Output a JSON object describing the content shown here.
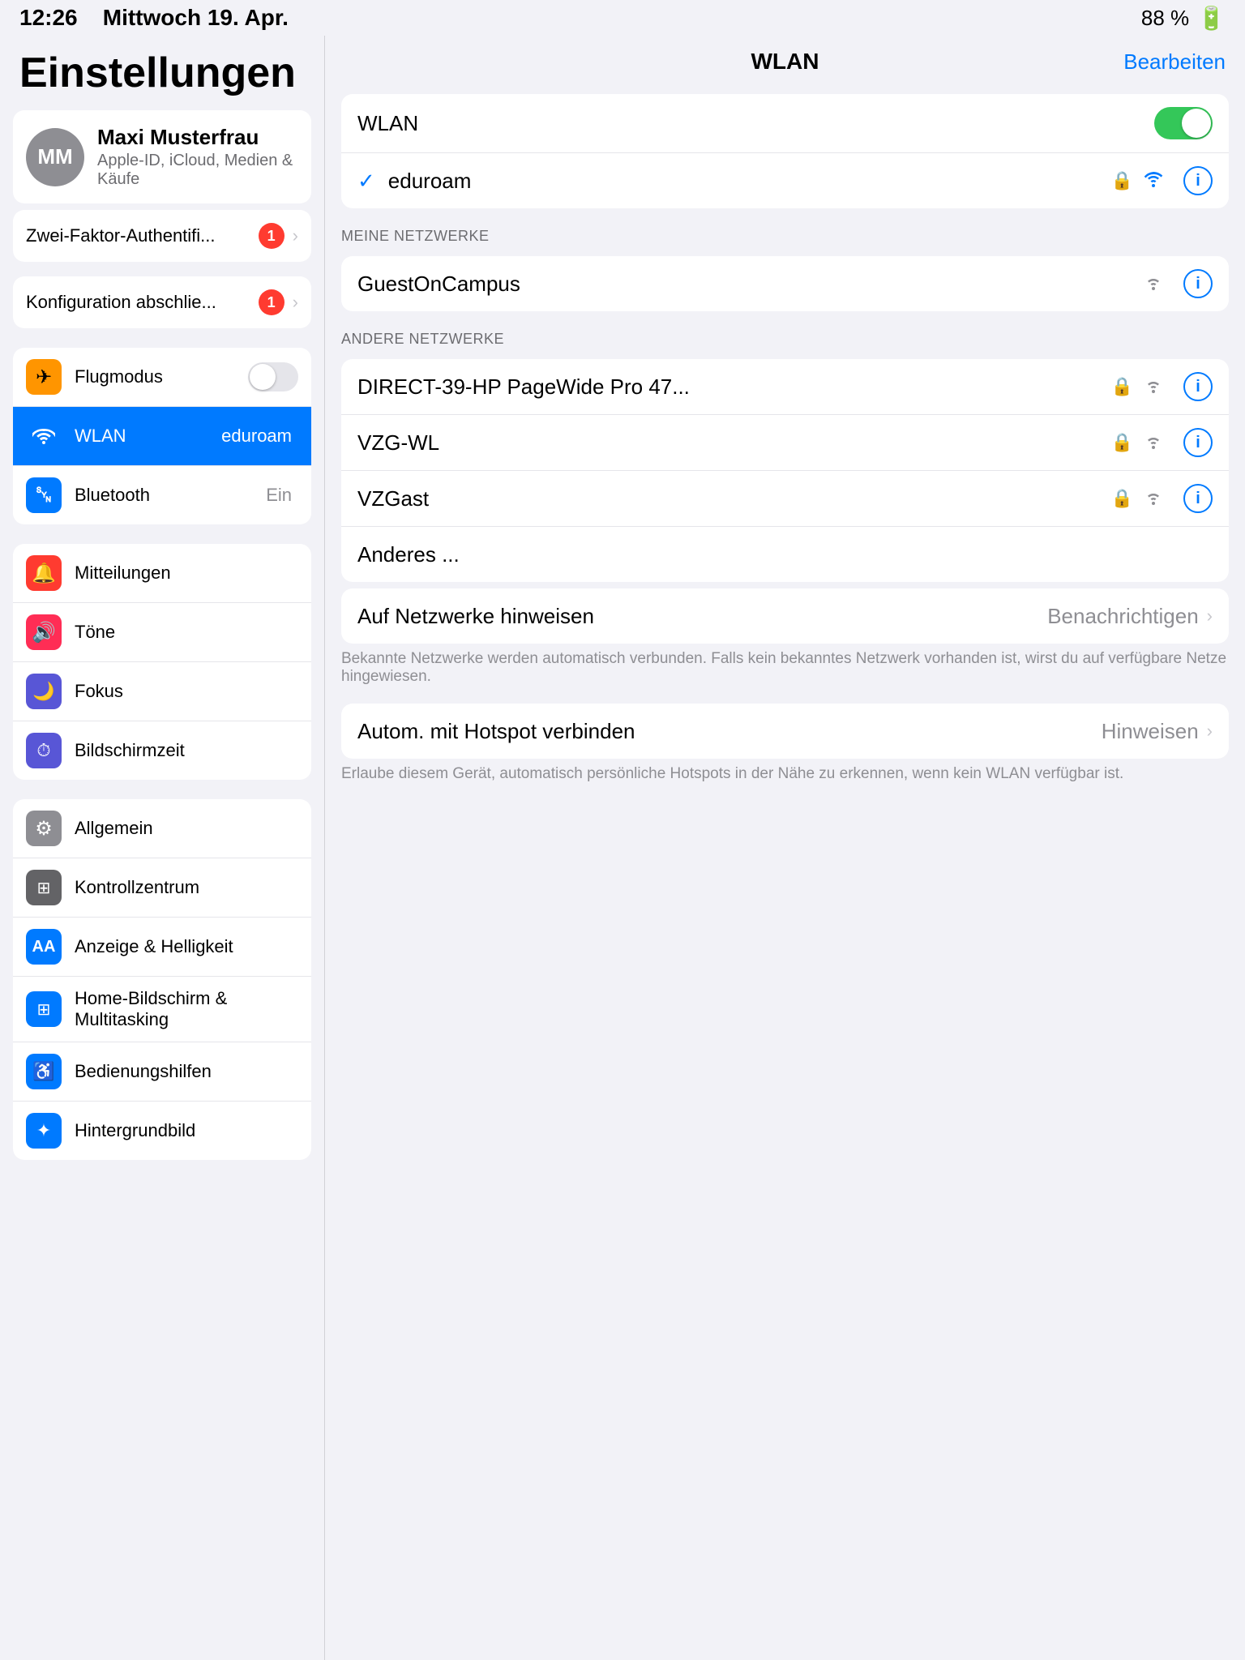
{
  "statusBar": {
    "time": "12:26",
    "day": "Mittwoch 19. Apr.",
    "battery": "88 %"
  },
  "sidebar": {
    "title": "Einstellungen",
    "account": {
      "initials": "MM",
      "name": "Maxi Musterfrau",
      "subtitle": "Apple-ID, iCloud, Medien & Käufe"
    },
    "twoFactor": {
      "label": "Zwei-Faktor-Authentifi...",
      "badge": "1"
    },
    "config": {
      "label": "Konfiguration abschlie...",
      "badge": "1"
    },
    "group1": [
      {
        "id": "flugmodus",
        "icon": "✈",
        "iconColor": "orange",
        "label": "Flugmodus",
        "toggle": true,
        "toggleOn": false
      },
      {
        "id": "wlan",
        "icon": "📶",
        "iconColor": "blue",
        "label": "WLAN",
        "value": "eduroam",
        "selected": true
      },
      {
        "id": "bluetooth",
        "icon": "🔵",
        "iconColor": "blue2",
        "label": "Bluetooth",
        "value": "Ein"
      }
    ],
    "group2": [
      {
        "id": "mitteilungen",
        "icon": "🔔",
        "iconColor": "red",
        "label": "Mitteilungen"
      },
      {
        "id": "toene",
        "icon": "🔊",
        "iconColor": "red2",
        "label": "Töne"
      },
      {
        "id": "fokus",
        "icon": "🌙",
        "iconColor": "indigo",
        "label": "Fokus"
      },
      {
        "id": "bildschirmzeit",
        "icon": "⏱",
        "iconColor": "purple",
        "label": "Bildschirmzeit"
      }
    ],
    "group3": [
      {
        "id": "allgemein",
        "icon": "⚙",
        "iconColor": "gray",
        "label": "Allgemein"
      },
      {
        "id": "kontrollzentrum",
        "icon": "🔲",
        "iconColor": "gray2",
        "label": "Kontrollzentrum"
      },
      {
        "id": "anzeige",
        "icon": "AA",
        "iconColor": "blue2",
        "label": "Anzeige & Helligkeit"
      },
      {
        "id": "home",
        "icon": "⊞",
        "iconColor": "blue",
        "label": "Home-Bildschirm & Multitasking"
      },
      {
        "id": "bedienungshilfen",
        "icon": "♿",
        "iconColor": "blue2",
        "label": "Bedienungshilfen"
      },
      {
        "id": "hintergrundbild",
        "icon": "✦",
        "iconColor": "blue",
        "label": "Hintergrundbild"
      }
    ]
  },
  "rightPanel": {
    "title": "WLAN",
    "editButton": "Bearbeiten",
    "wlanToggle": {
      "label": "WLAN",
      "on": true
    },
    "connectedNetwork": {
      "name": "eduroam",
      "secured": true,
      "signalStrength": 3
    },
    "mineNetworksHeader": "MEINE NETZWERKE",
    "myNetworks": [
      {
        "name": "GuestOnCampus",
        "secured": false,
        "signalStrength": 2
      }
    ],
    "otherNetworksHeader": "ANDERE NETZWERKE",
    "otherNetworks": [
      {
        "name": "DIRECT-39-HP PageWide Pro 47...",
        "secured": true,
        "signalStrength": 2
      },
      {
        "name": "VZG-WL",
        "secured": true,
        "signalStrength": 2
      },
      {
        "name": "VZGast",
        "secured": true,
        "signalStrength": 2
      },
      {
        "name": "Anderes ...",
        "secured": false,
        "signalStrength": 0
      }
    ],
    "notifySection": {
      "label": "Auf Netzwerke hinweisen",
      "value": "Benachrichtigen",
      "description": "Bekannte Netzwerke werden automatisch verbunden. Falls kein bekanntes Netzwerk vorhanden ist, wirst du auf verfügbare Netze hingewiesen."
    },
    "hotspotSection": {
      "label": "Autom. mit Hotspot verbinden",
      "value": "Hinweisen",
      "description": "Erlaube diesem Gerät, automatisch persönliche Hotspots in der Nähe zu erkennen, wenn kein WLAN verfügbar ist."
    }
  }
}
